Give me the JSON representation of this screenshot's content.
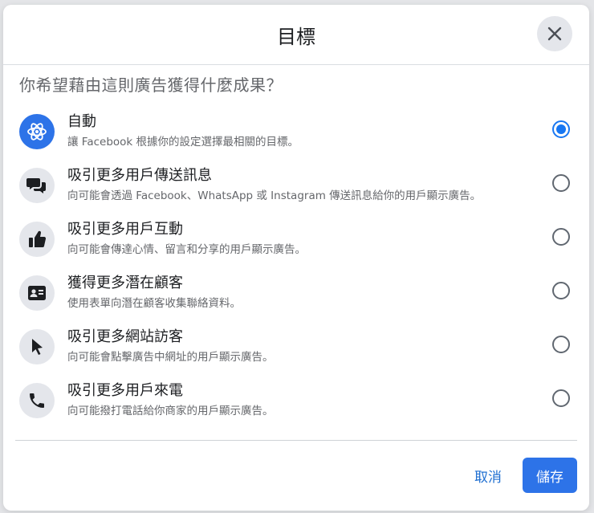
{
  "dialog": {
    "title": "目標",
    "question": "你希望藉由這則廣告獲得什麼成果？",
    "options": [
      {
        "icon": "atom-icon",
        "title": "自動",
        "description": "讓 Facebook 根據你的設定選擇最相關的目標。",
        "selected": true
      },
      {
        "icon": "chat-bubbles-icon",
        "title": "吸引更多用戶傳送訊息",
        "description": "向可能會透過 Facebook、WhatsApp 或 Instagram 傳送訊息給你的用戶顯示廣告。",
        "selected": false
      },
      {
        "icon": "thumbs-up-icon",
        "title": "吸引更多用戶互動",
        "description": "向可能會傳達心情、留言和分享的用戶顯示廣告。",
        "selected": false
      },
      {
        "icon": "contact-card-icon",
        "title": "獲得更多潛在顧客",
        "description": "使用表單向潛在顧客收集聯絡資料。",
        "selected": false
      },
      {
        "icon": "cursor-arrow-icon",
        "title": "吸引更多網站訪客",
        "description": "向可能會點擊廣告中網址的用戶顯示廣告。",
        "selected": false
      },
      {
        "icon": "phone-icon",
        "title": "吸引更多用戶來電",
        "description": "向可能撥打電話給你商家的用戶顯示廣告。",
        "selected": false
      }
    ],
    "cancel_label": "取消",
    "save_label": "儲存"
  },
  "colors": {
    "accent": "#2d73e8",
    "link": "#1f6fd1",
    "icon_bg": "#e4e6eb"
  }
}
